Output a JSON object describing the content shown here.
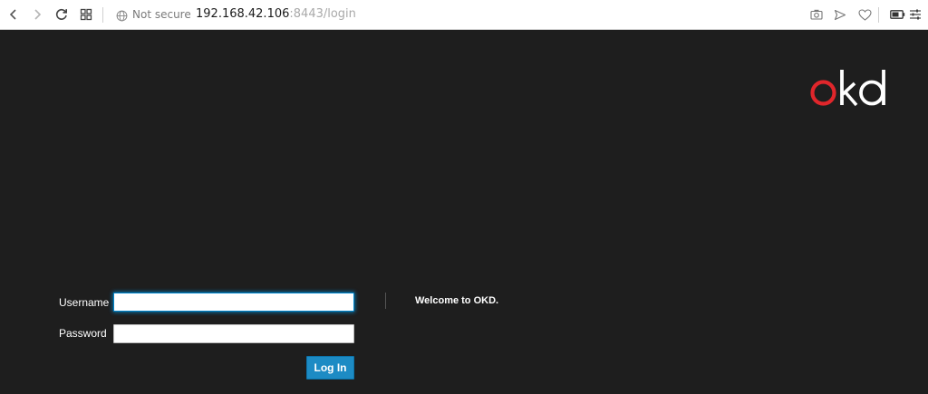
{
  "browser": {
    "security_label": "Not secure",
    "url_host": "192.168.42.106",
    "url_rest": ":8443/login",
    "icons": {
      "back": "back-arrow-icon",
      "forward": "forward-arrow-icon",
      "reload": "reload-icon",
      "speed_dial": "grid-icon",
      "security": "globe-icon",
      "snapshot": "camera-icon",
      "send": "send-icon",
      "bookmark": "heart-icon",
      "battery": "battery-icon",
      "easy_setup": "sliders-icon"
    }
  },
  "brand": {
    "logo_text": "okd",
    "colors": {
      "o": "#e0262b",
      "kd": "#ffffff"
    }
  },
  "login": {
    "username_label": "Username",
    "username_value": "",
    "password_label": "Password",
    "password_value": "",
    "submit_label": "Log In",
    "welcome": "Welcome to OKD.",
    "accent_color": "#1d8bc4"
  },
  "page": {
    "background": "#1e1e1e"
  }
}
